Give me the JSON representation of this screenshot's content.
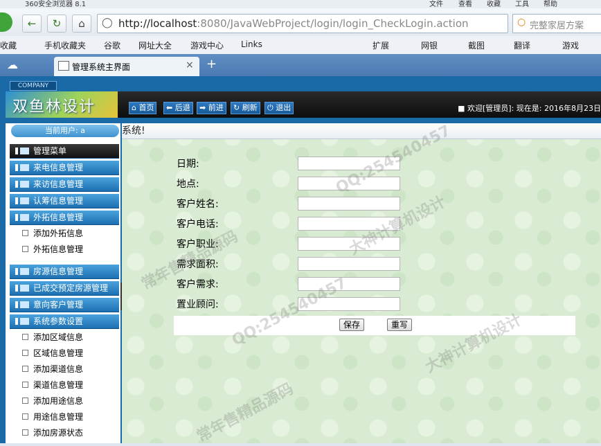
{
  "browser": {
    "title": "360安全浏览器 8.1",
    "top_menu": [
      "文件",
      "查看",
      "收藏",
      "工具",
      "帮助"
    ],
    "url_host": "http://localhost",
    "url_rest": ":8080/JavaWebProject/login/login_CheckLogin.action",
    "search_placeholder": "完整家居方案",
    "bookmarks": [
      "收藏",
      "手机收藏夹",
      "谷歌",
      "网址大全",
      "游戏中心",
      "Links",
      "扩展",
      "网银",
      "截图",
      "翻译",
      "游戏"
    ],
    "tab_title": "管理系统主界面",
    "new_tab": "+"
  },
  "app": {
    "company": "COMPANY",
    "logo": "双鱼林设计",
    "toolbar": [
      "首页",
      "后退",
      "前进",
      "刷新",
      "退出"
    ],
    "welcome": "欢迎[管理员]:",
    "date": "现在是: 2016年8月23日"
  },
  "sidebar": {
    "current_user": "当前用户: a",
    "menu_title": "管理菜单",
    "groups1": [
      "来电信息管理",
      "来访信息管理",
      "认筹信息管理",
      "外拓信息管理"
    ],
    "subs1": [
      "添加外拓信息",
      "外拓信息管理"
    ],
    "groups2": [
      "房源信息管理",
      "已成交预定房源管理",
      "意向客户管理",
      "系统参数设置"
    ],
    "subs2": [
      "添加区域信息",
      "区域信息管理",
      "添加渠道信息",
      "渠道信息管理",
      "添加用途信息",
      "用途信息管理",
      "添加房源状态"
    ]
  },
  "main": {
    "title": "系统!",
    "labels": [
      "日期:",
      "地点:",
      "客户姓名:",
      "客户电话:",
      "客户职业:",
      "需求面积:",
      "客户需求:",
      "置业顾问:"
    ],
    "values": [
      "",
      "",
      "",
      "",
      "",
      "",
      "",
      ""
    ],
    "save": "保存",
    "reset": "重写"
  },
  "watermarks": [
    "QQ:254540457",
    "大神计算机设计",
    "常年售精品源码"
  ]
}
